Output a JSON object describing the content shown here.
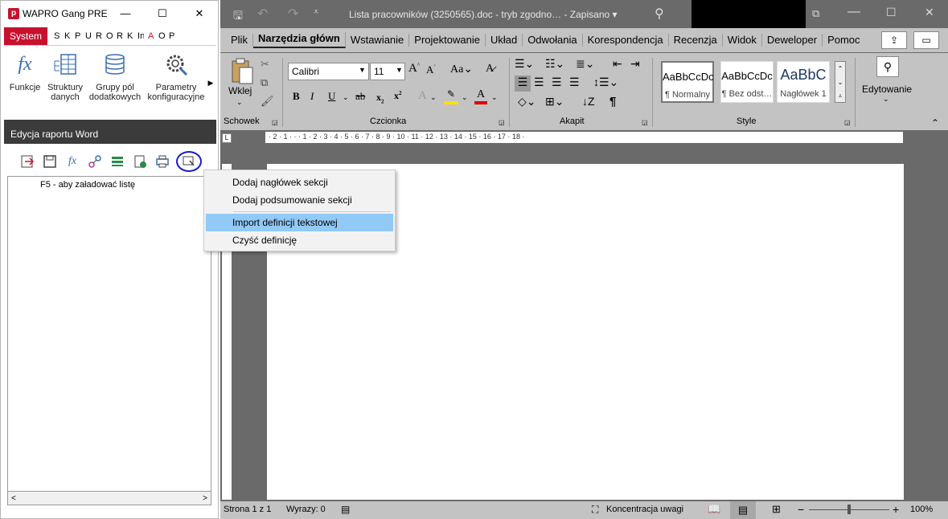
{
  "app": {
    "logo": "p",
    "title": "WAPRO Gang PREST…",
    "tabs": [
      "System",
      "St",
      "K:",
      "Pl",
      "Ul",
      "R:",
      "O",
      "R:",
      "K:",
      "In",
      "A",
      "O",
      "P:"
    ],
    "ribbon": [
      {
        "label": "Funkcje",
        "icon": "fx-icon"
      },
      {
        "label": "Struktury danych",
        "icon": "table-structure-icon"
      },
      {
        "label": "Grupy pól dodatkowych",
        "icon": "database-icon"
      },
      {
        "label": "Parametry konfiguracyjne",
        "icon": "gear-wrench-icon"
      }
    ],
    "panel_title": "Edycja raportu Word",
    "tree_hint": "F5 - aby załadować listę"
  },
  "context_menu": {
    "items": [
      "Dodaj nagłówek sekcji",
      "Dodaj podsumowanie sekcji",
      "Import definicji tekstowej",
      "Czyść definicję"
    ],
    "highlighted_index": 2
  },
  "word": {
    "title": "Lista pracowników (3250565).doc  -  tryb zgodno…  -  Zapisano  ▾",
    "tabs": [
      "Plik",
      "Narzędzia główn",
      "Wstawianie",
      "Projektowanie",
      "Układ",
      "Odwołania",
      "Korespondencja",
      "Recenzja",
      "Widok",
      "Deweloper",
      "Pomoc"
    ],
    "active_tab": "Narzędzia główn",
    "paste_label": "Wklej",
    "font_name": "Calibri",
    "font_size": "11",
    "groups": [
      "Schowek",
      "Czcionka",
      "Akapit",
      "Style"
    ],
    "styles": [
      {
        "preview": "AaBbCcDc",
        "name": "¶ Normalny"
      },
      {
        "preview": "AaBbCcDc",
        "name": "¶ Bez odst…"
      },
      {
        "preview": "AaBbC",
        "name": "Nagłówek 1"
      }
    ],
    "editing_label": "Edytowanie",
    "ruler": "· 2 · 1 · · · 1 · 2 · 3 · 4 · 5 · 6 · 7 · 8 · 9 · 10 · 11 · 12 · 13 · 14 · 15 · 16 · 17 · 18 ·",
    "status": {
      "page": "Strona 1 z 1",
      "words": "Wyrazy: 0",
      "focus": "Koncentracja uwagi",
      "zoom": "100%"
    }
  }
}
